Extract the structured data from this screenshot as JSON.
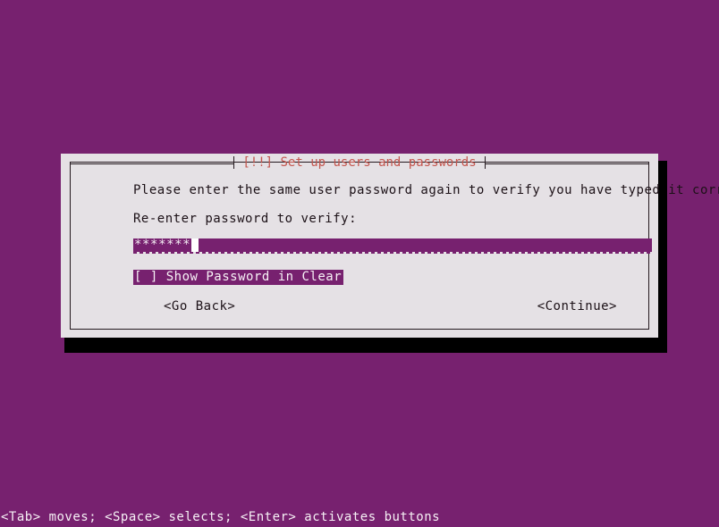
{
  "screen": {
    "background_color": "#77216F",
    "foreground_color": "#F6F1F5"
  },
  "dialog": {
    "title": "[!!] Set up users and passwords",
    "title_color": "#C4564E",
    "background_color": "#E5E1E5",
    "border_color": "#24191F",
    "shadow_color": "#000000",
    "body_text": "Please enter the same user password again to verify you have typed it correctly.",
    "prompt_label": "Re-enter password to verify:",
    "password_field": {
      "value": "*******",
      "masked_char": "*",
      "placeholder": "",
      "highlight_color": "#77216F",
      "text_color": "#F4EDF3",
      "cursor_visible": true
    },
    "checkbox": {
      "label": "[ ] Show Password in Clear",
      "checked": false,
      "focused": true,
      "highlight_color": "#77216F",
      "text_color": "#F7F2F6"
    },
    "buttons": {
      "back_label": "<Go Back>",
      "continue_label": "<Continue>"
    }
  },
  "statusbar": {
    "hint": "<Tab> moves; <Space> selects; <Enter> activates buttons"
  }
}
